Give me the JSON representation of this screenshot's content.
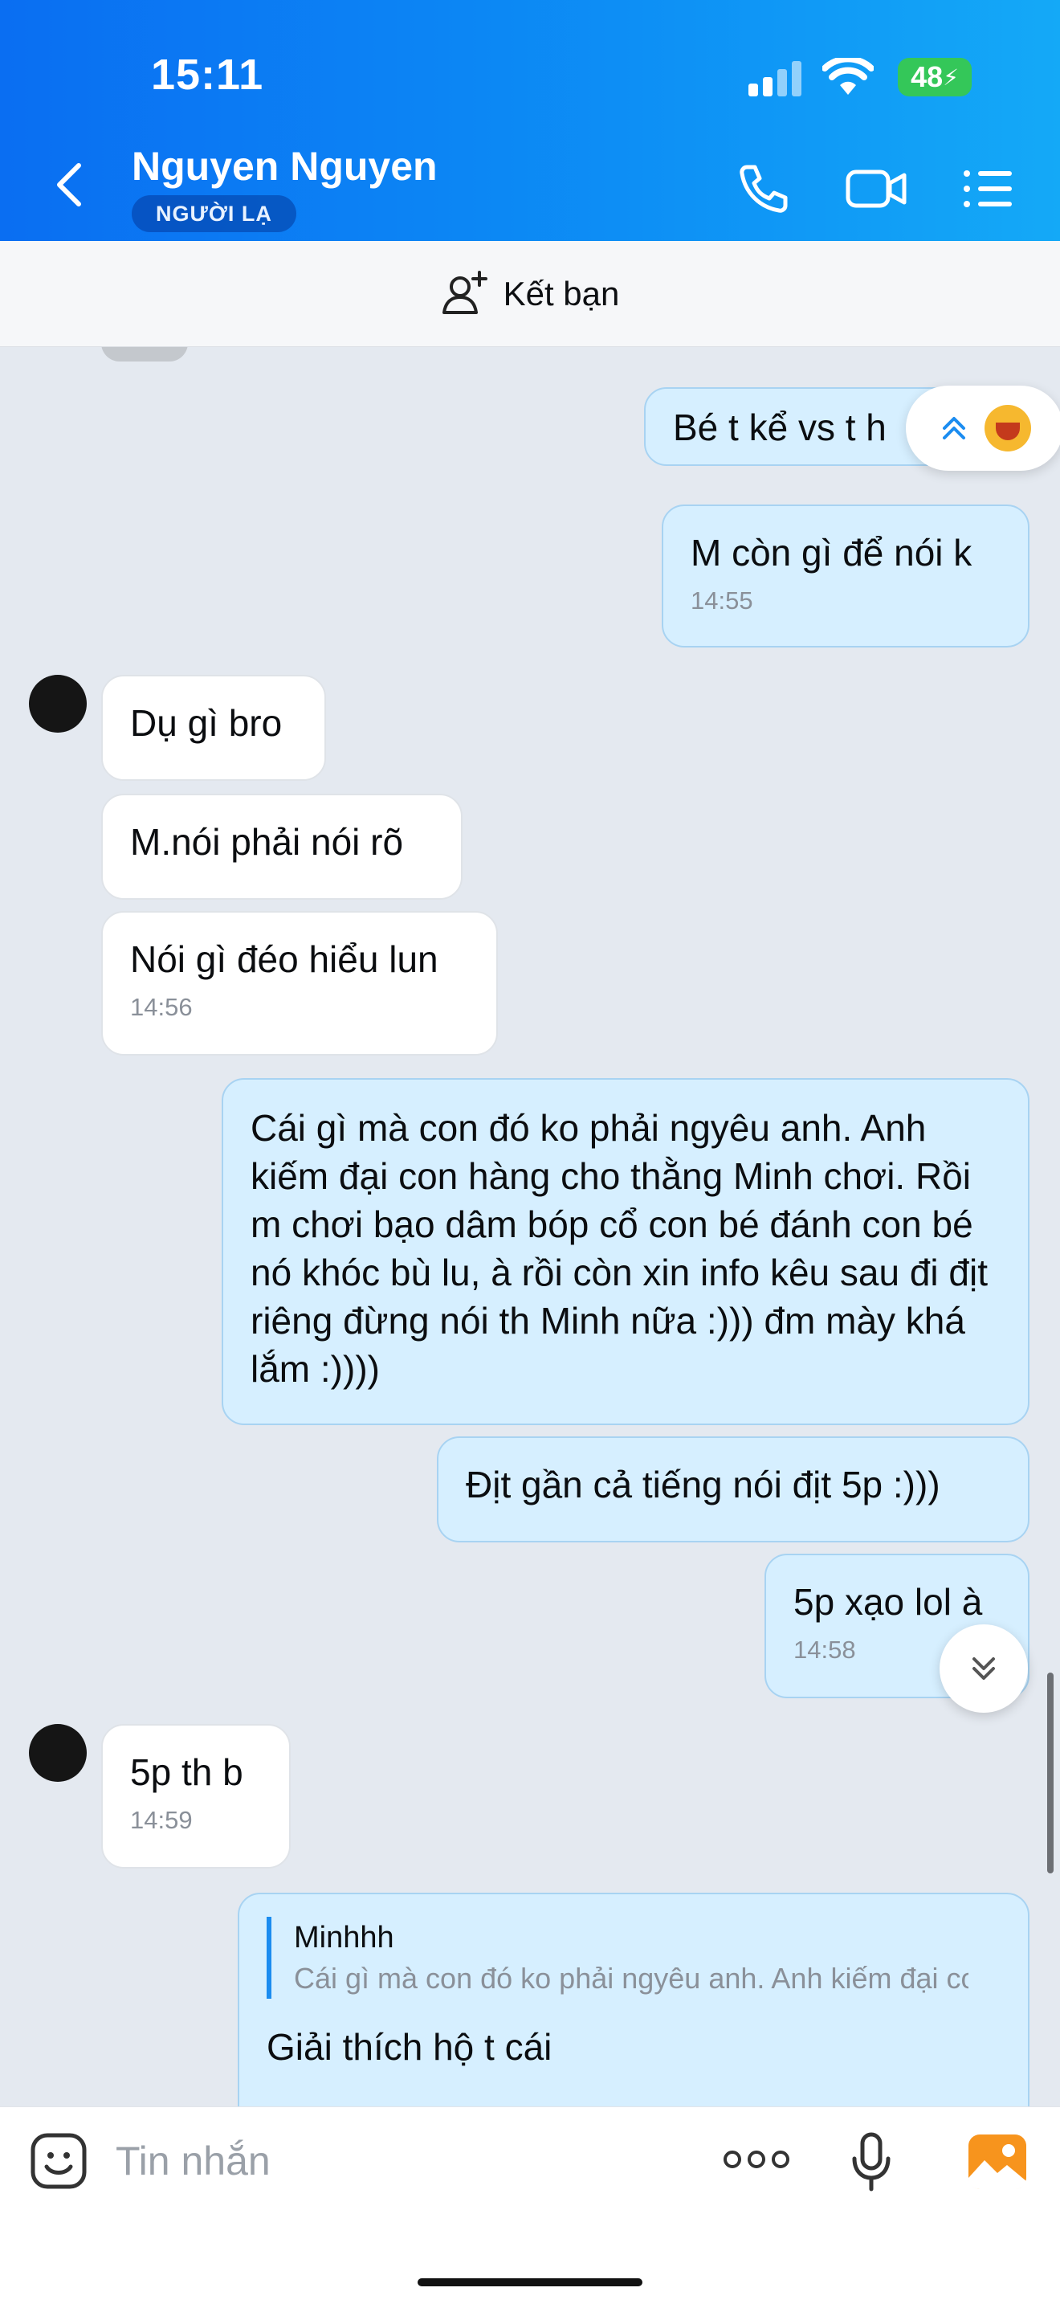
{
  "status_bar": {
    "time": "15:11",
    "battery": "48"
  },
  "header": {
    "name": "Nguyen Nguyen",
    "badge": "NGƯỜI LẠ"
  },
  "friend_bar": {
    "label": "Kết bạn"
  },
  "messages": [
    {
      "side": "out",
      "text": "Bé t kể vs t h",
      "time": ""
    },
    {
      "side": "out",
      "text": "M còn gì để nói k",
      "time": "14:55"
    },
    {
      "side": "in",
      "text": "Dụ gì bro",
      "time": ""
    },
    {
      "side": "in",
      "text": "M.nói phải nói rõ",
      "time": ""
    },
    {
      "side": "in",
      "text": "Nói gì đéo hiểu lun",
      "time": "14:56"
    },
    {
      "side": "out",
      "text": "Cái gì mà con đó ko phải ngyêu anh. Anh kiếm đại con hàng cho thằng Minh chơi. Rồi m chơi bạo dâm bóp cổ con bé đánh con bé nó khóc bù lu, à rồi còn xin info kêu sau đi địt riêng đừng nói th Minh nữa :))) đm mày khá lắm :))))",
      "time": ""
    },
    {
      "side": "out",
      "text": "Địt gần cả tiếng nói địt 5p :)))",
      "time": ""
    },
    {
      "side": "out",
      "text": "5p xạo lol à",
      "time": "14:58"
    },
    {
      "side": "in",
      "text": "5p th b",
      "time": "14:59"
    },
    {
      "side": "out",
      "text": "Giải thích hộ t cái",
      "time": "",
      "reply_to": {
        "name": "Minhhh",
        "text": "Cái gì mà con đó ko phải ngyêu anh. Anh kiếm đại con hàng cho thằng Minh chơi."
      }
    }
  ],
  "composer": {
    "placeholder": "Tin nhắn"
  }
}
